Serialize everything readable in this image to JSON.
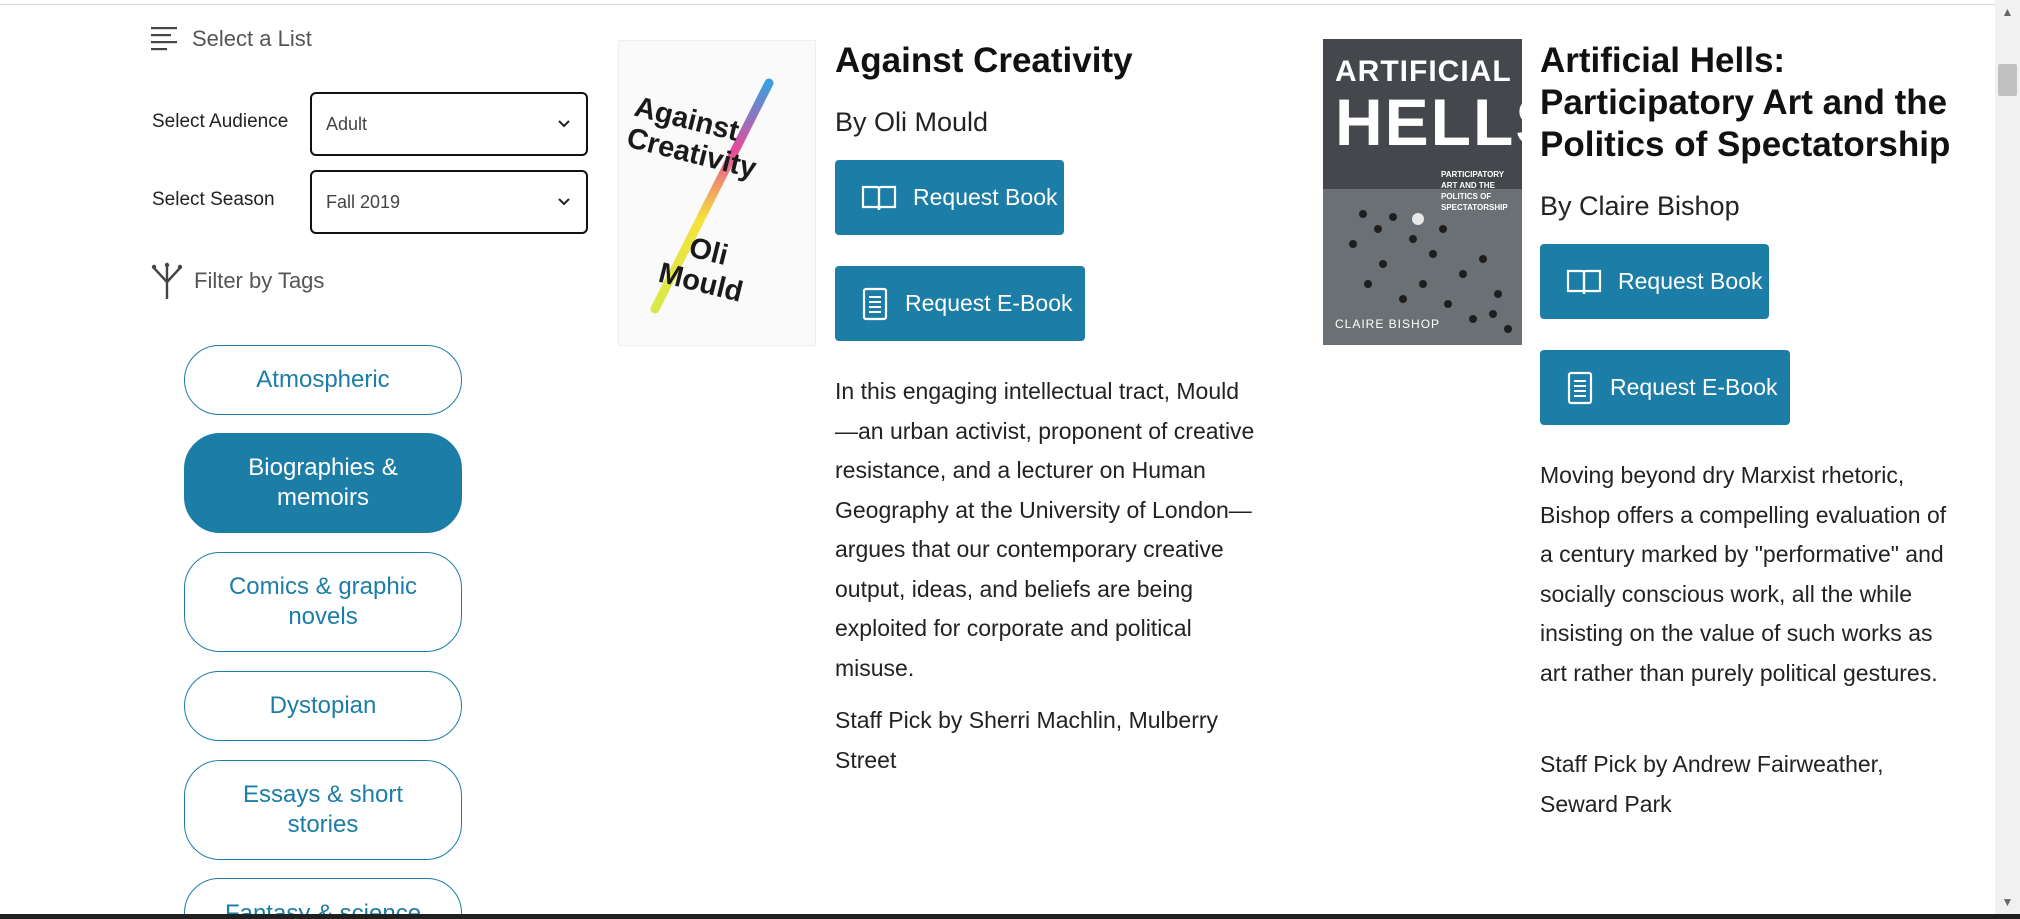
{
  "sidebar": {
    "select_list_label": "Select a List",
    "audience_label": "Select Audience",
    "audience_value": "Adult",
    "season_label": "Select Season",
    "season_value": "Fall 2019",
    "filter_label": "Filter by Tags",
    "tags": [
      {
        "label": "Atmospheric",
        "active": false
      },
      {
        "label": "Biographies & memoirs",
        "active": true
      },
      {
        "label": "Comics & graphic novels",
        "active": false
      },
      {
        "label": "Dystopian",
        "active": false
      },
      {
        "label": "Essays & short stories",
        "active": false
      },
      {
        "label": "Fantasy & science",
        "active": false
      }
    ]
  },
  "books": [
    {
      "title": "Against Creativity",
      "author": "By Oli Mould",
      "cover_text_top": "Against Creativity",
      "cover_text_bottom": "Oli Mould",
      "request_book": "Request Book",
      "request_ebook": "Request E-Book",
      "description": "In this engaging intellectual tract, Mould—an urban activist, proponent of creative resistance, and a lecturer on Human Geography at the University of London—argues that our contemporary creative output, ideas, and beliefs are being exploited for corporate and political misuse.",
      "staff_pick": "Staff Pick by Sherri Machlin, Mulberry Street"
    },
    {
      "title": "Artificial Hells: Participatory Art and the Politics of Spectatorship",
      "author": "By Claire Bishop",
      "cover_title_1": "ARTIFICIAL",
      "cover_title_2": "HELLS",
      "cover_subtitle": "PARTICIPATORY ART AND THE POLITICS OF SPECTATORSHIP",
      "cover_author": "CLAIRE BISHOP",
      "request_book": "Request Book",
      "request_ebook": "Request E-Book",
      "description": "Moving beyond dry Marxist rhetoric, Bishop offers a compelling evaluation of a century marked by \"performative\" and socially conscious work, all the while insisting on the value of such works as art rather than purely political gestures.",
      "staff_pick": "Staff Pick by Andrew Fairweather, Seward Park"
    }
  ],
  "colors": {
    "accent": "#1c7da6",
    "text": "#222222"
  }
}
